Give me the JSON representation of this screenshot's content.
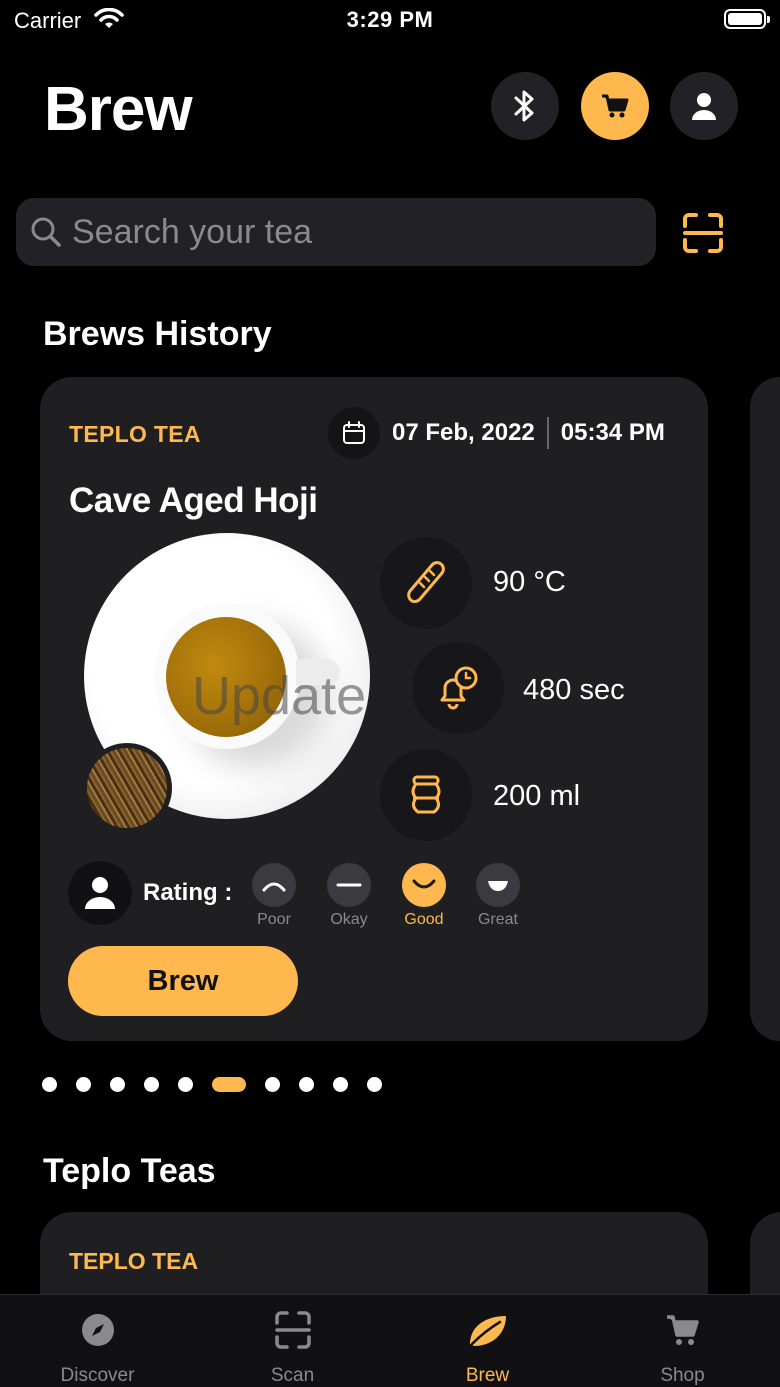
{
  "status": {
    "carrier": "Carrier",
    "time": "3:29 PM"
  },
  "header": {
    "title": "Brew"
  },
  "search": {
    "placeholder": "Search your tea"
  },
  "sections": {
    "history": "Brews History",
    "teas": "Teplo Teas"
  },
  "brew_card": {
    "brand": "TEPLO TEA",
    "date": "07 Feb, 2022",
    "time": "05:34 PM",
    "name": "Cave Aged Hoji",
    "overlay_text": "Update",
    "temperature": "90 °C",
    "steep_time": "480 sec",
    "volume": "200 ml",
    "rating_label": "Rating :",
    "ratings": [
      {
        "label": "Poor",
        "icon": "frown-icon"
      },
      {
        "label": "Okay",
        "icon": "neutral-icon"
      },
      {
        "label": "Good",
        "icon": "smile-icon"
      },
      {
        "label": "Great",
        "icon": "grin-icon"
      }
    ],
    "selected_rating": "Good",
    "brew_button": "Brew"
  },
  "pagination": {
    "count": 10,
    "active_index": 5
  },
  "tea_card": {
    "brand": "TEPLO TEA"
  },
  "tabs": [
    {
      "label": "Discover",
      "icon": "compass-icon"
    },
    {
      "label": "Scan",
      "icon": "scan-icon"
    },
    {
      "label": "Brew",
      "icon": "leaf-icon"
    },
    {
      "label": "Shop",
      "icon": "cart-icon"
    }
  ],
  "active_tab": "Brew",
  "colors": {
    "accent": "#ffb84d",
    "card": "#1f1f22",
    "background": "#000000"
  }
}
